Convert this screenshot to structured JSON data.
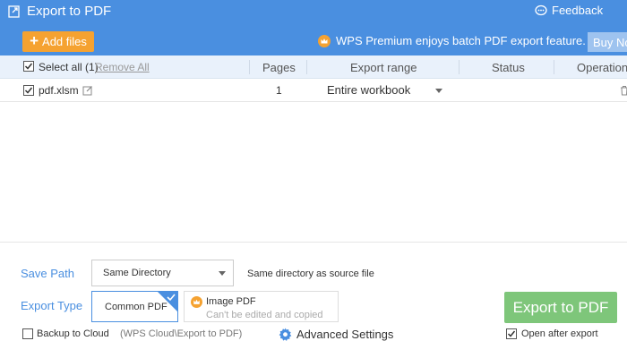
{
  "header": {
    "title": "Export to PDF",
    "feedback": "Feedback",
    "add_files": "Add files",
    "premium_text": "WPS Premium enjoys batch PDF export feature.",
    "buy_now": "Buy Now"
  },
  "table": {
    "select_all": "Select all (1)",
    "remove_all": "Remove All",
    "columns": {
      "pages": "Pages",
      "export_range": "Export range",
      "status": "Status",
      "operation": "Operation"
    },
    "rows": [
      {
        "file": "pdf.xlsm",
        "pages": "1",
        "export_range": "Entire workbook",
        "status": ""
      }
    ]
  },
  "settings": {
    "save_path_label": "Save Path",
    "save_path_value": "Same Directory",
    "save_path_hint": "Same directory as source file",
    "export_type_label": "Export Type",
    "common_pdf": "Common PDF",
    "image_pdf": "Image PDF",
    "image_pdf_note": "Can't be edited and copied",
    "backup_label": "Backup to Cloud",
    "backup_path": "(WPS Cloud\\Export to PDF)",
    "advanced": "Advanced Settings",
    "export_button": "Export to PDF",
    "open_after": "Open after export"
  },
  "colors": {
    "header_bg": "#4a8fe0",
    "add_button": "#f5a231",
    "export_button": "#7ec67a",
    "premium_badge": "#f5a231"
  }
}
